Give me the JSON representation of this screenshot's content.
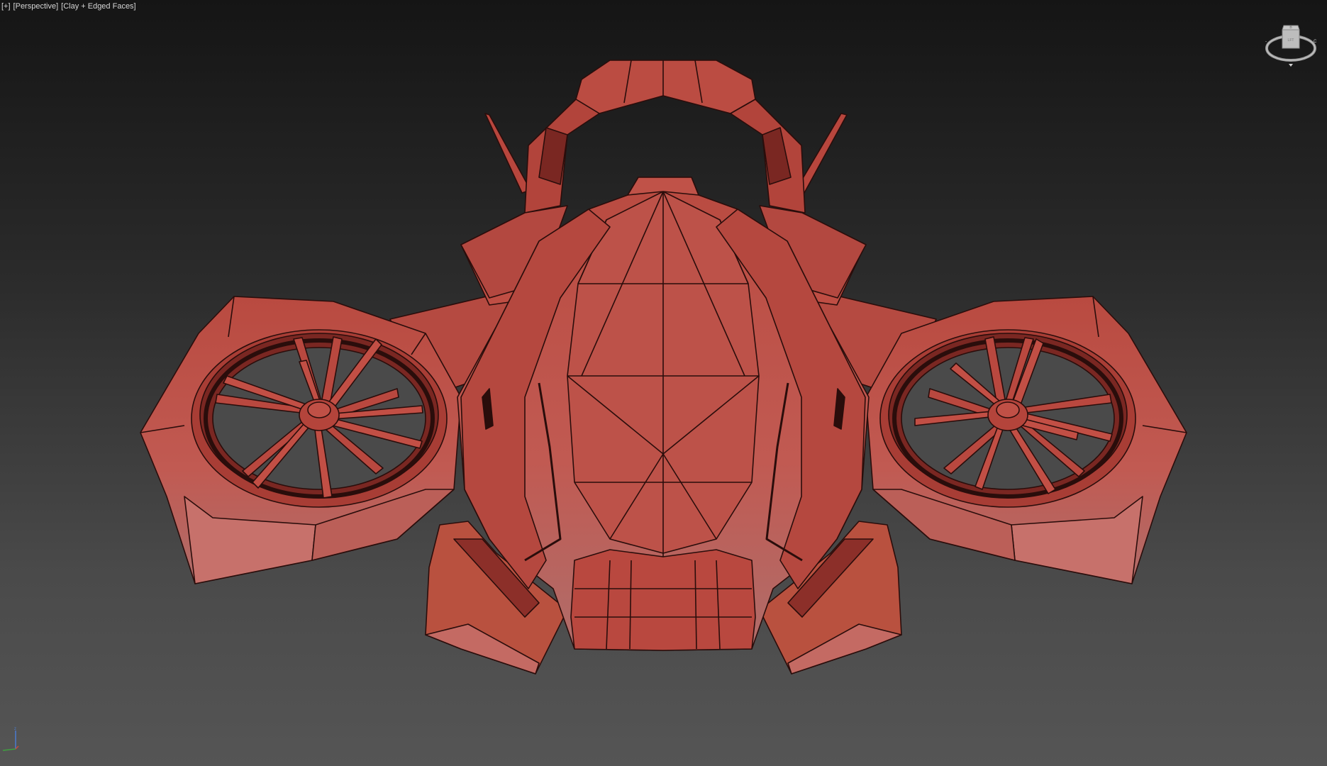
{
  "viewport": {
    "label_plus": "[+]",
    "label_view": "[Perspective]",
    "label_shading": "[Clay + Edged Faces]"
  },
  "colors": {
    "clay": "#b9483f",
    "clay_light": "#c96a62",
    "clay_dark": "#8a2f2a",
    "edge": "#2a0d0b",
    "background_top": "#151515",
    "background_bottom": "#555555",
    "viewcube": "#b8b8b8"
  },
  "icons": {
    "viewcube": "viewcube-icon",
    "axis": "axis-tripod-icon"
  }
}
